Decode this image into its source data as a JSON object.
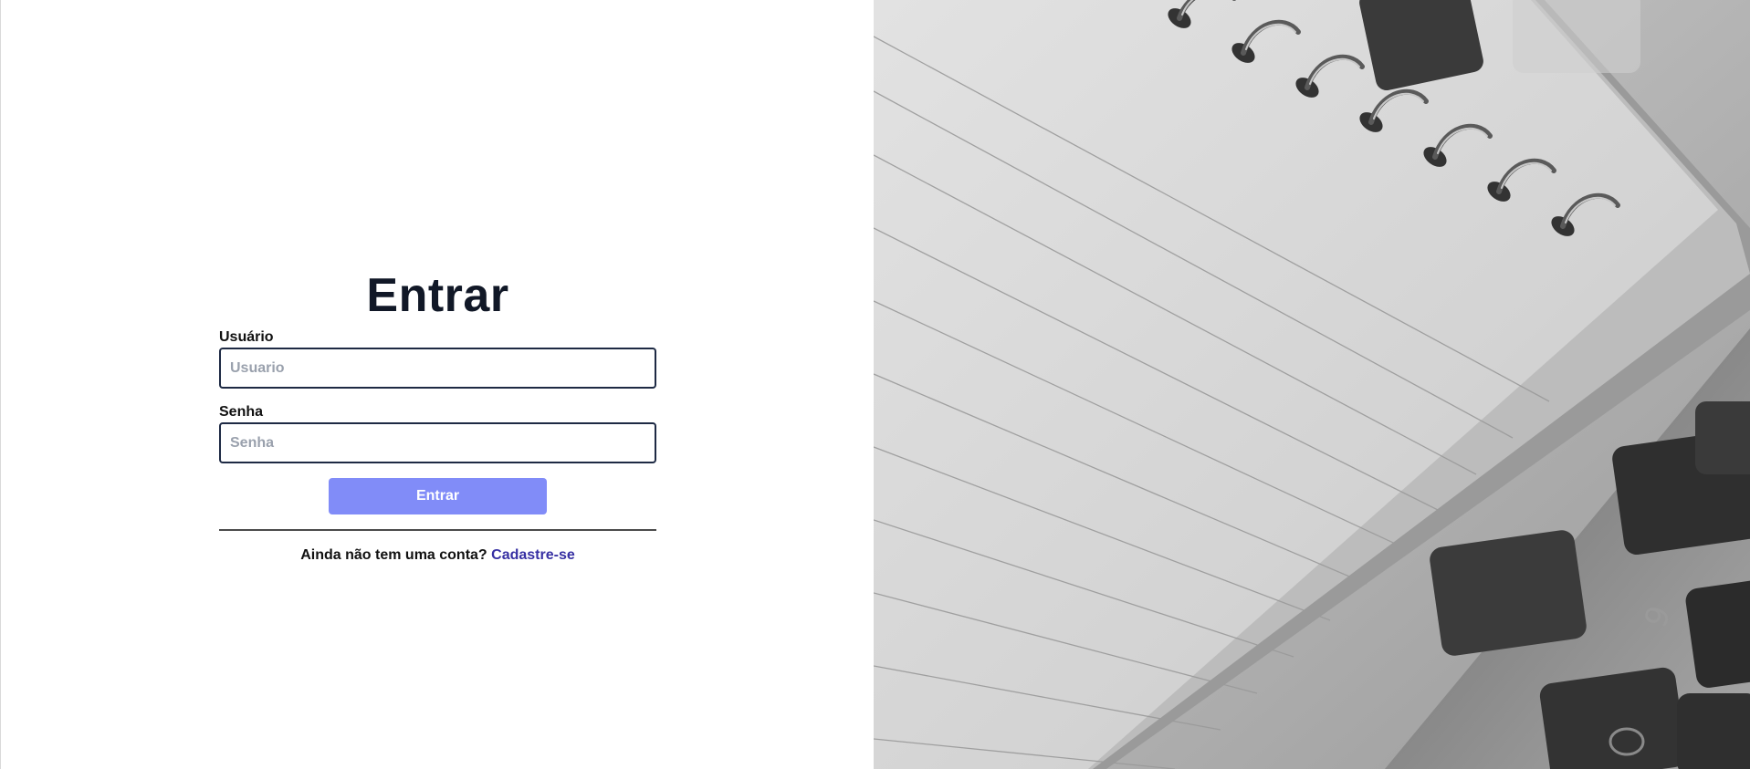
{
  "login": {
    "title": "Entrar",
    "username": {
      "label": "Usuário",
      "placeholder": "Usuario",
      "value": ""
    },
    "password": {
      "label": "Senha",
      "placeholder": "Senha",
      "value": ""
    },
    "submit_label": "Entrar",
    "signup_prompt": "Ainda não tem uma conta?",
    "signup_link": "Cadastre-se"
  },
  "hero": {
    "image_subject": "notebook-and-keyboard-photo"
  },
  "colors": {
    "title": "#111827",
    "input_border": "#1e2a44",
    "button_bg": "#818cf8",
    "button_text": "#ffffff",
    "link": "#3730a3",
    "divider": "#4b4b4b"
  }
}
